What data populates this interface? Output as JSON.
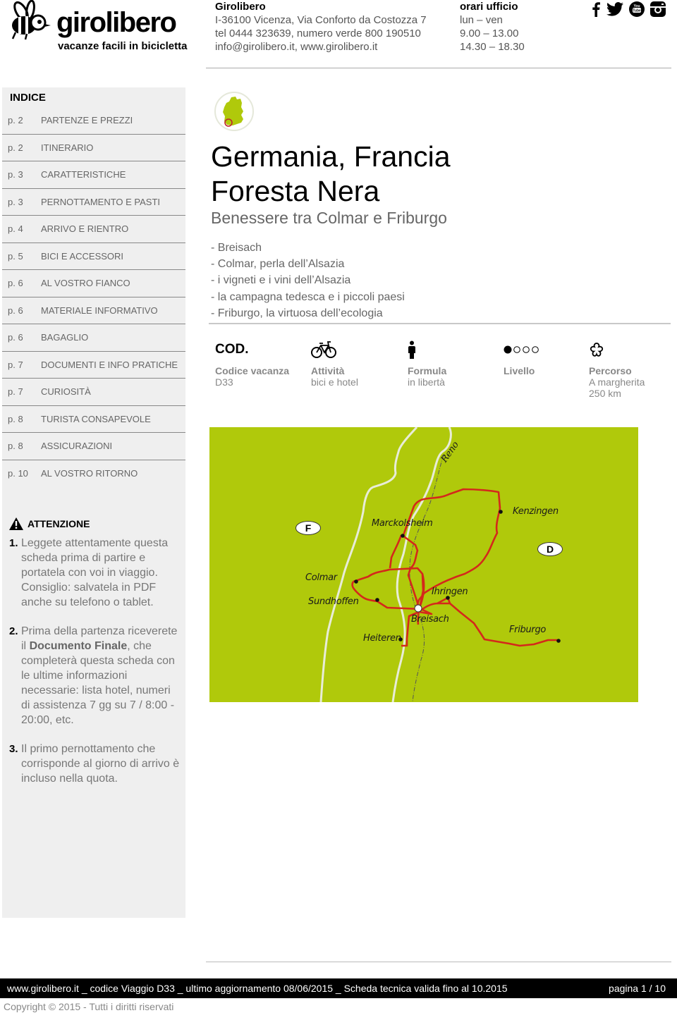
{
  "header": {
    "brand_name": "girolibero",
    "tagline": "vacanze facili in bicicletta",
    "contact": {
      "company": "Girolibero",
      "address": "I-36100 Vicenza, Via Conforto da Costozza 7",
      "phone": "tel 0444 323639, numero verde 800 190510",
      "web": "info@girolibero.it, www.girolibero.it"
    },
    "office_hours": {
      "title": "orari ufficio",
      "days": "lun – ven",
      "morning": "9.00 – 13.00",
      "afternoon": "14.30 – 18.30"
    },
    "social_icons": [
      "facebook-icon",
      "twitter-icon",
      "youtube-icon",
      "instagram-icon"
    ]
  },
  "index": {
    "title": "INDICE",
    "items": [
      {
        "page": "p. 2",
        "label": "PARTENZE E PREZZI"
      },
      {
        "page": "p. 2",
        "label": "ITINERARIO"
      },
      {
        "page": "p. 3",
        "label": "CARATTERISTICHE"
      },
      {
        "page": "p. 3",
        "label": "PERNOTTAMENTO E PASTI"
      },
      {
        "page": "p. 4",
        "label": "ARRIVO E RIENTRO"
      },
      {
        "page": "p. 5",
        "label": "BICI E ACCESSORI"
      },
      {
        "page": "p. 6",
        "label": "AL VOSTRO FIANCO"
      },
      {
        "page": "p. 6",
        "label": "MATERIALE INFORMATIVO"
      },
      {
        "page": "p. 6",
        "label": "BAGAGLIO"
      },
      {
        "page": "p. 7",
        "label": "DOCUMENTI E INFO PRATICHE"
      },
      {
        "page": "p. 7",
        "label": "CURIOSITÀ"
      },
      {
        "page": "p. 8",
        "label": "TURISTA CONSAPEVOLE"
      },
      {
        "page": "p. 8",
        "label": "ASSICURAZIONI"
      },
      {
        "page": "p. 10",
        "label": "AL VOSTRO RITORNO"
      }
    ]
  },
  "attention": {
    "title": "ATTENZIONE",
    "items": [
      {
        "num": "1.",
        "text": "Leggete attentamente questa scheda prima di partire e portatela con voi in viaggio. Consiglio: salvatela in PDF anche su telefono o tablet."
      },
      {
        "num": "2.",
        "pre": "Prima della partenza riceverete il ",
        "bold": "Documento Finale",
        "post": ", che completerà questa scheda con le ultime informazioni necessarie: lista hotel, numeri di assistenza 7 gg su 7 / 8:00 - 20:00, etc."
      },
      {
        "num": "3.",
        "text": "Il primo pernottamento che corrisponde al giorno di arrivo è incluso nella quota."
      }
    ]
  },
  "trip": {
    "title_line1": "Germania, Francia",
    "title_line2": "Foresta Nera",
    "subtitle": "Benessere tra Colmar e Friburgo",
    "highlights": [
      "- Breisach",
      "- Colmar, perla dell’Alsazia",
      "- i vigneti e i vini dell’Alsazia",
      "- la campagna tedesca e i piccoli paesi",
      "- Friburgo, la virtuosa dell’ecologia"
    ],
    "region_colors": {
      "country": "#b0c90b",
      "marker": "#c0272d"
    }
  },
  "features": {
    "code_heading": "COD.",
    "code": {
      "label": "Codice vacanza",
      "value": "D33"
    },
    "activity": {
      "label": "Attività",
      "value": "bici e hotel"
    },
    "formula": {
      "label": "Formula",
      "value": "in libertà"
    },
    "level": {
      "label": "Livello",
      "filled": 1,
      "total": 4
    },
    "route": {
      "label": "Percorso",
      "value": "A margherita",
      "distance": "250 km"
    }
  },
  "map": {
    "background": "#b0c90b",
    "route_color": "#d4281b",
    "river_label": "Reno",
    "countries": [
      "F",
      "D"
    ],
    "towns": [
      "Marckolsheim",
      "Kenzingen",
      "Colmar",
      "Sundhoffen",
      "Ihringen",
      "Breisach",
      "Heiteren",
      "Friburgo"
    ]
  },
  "footer": {
    "bar_text": "www.girolibero.it _ codice Viaggio D33 _ ultimo aggiornamento 08/06/2015 _ Scheda tecnica valida fino al 10.2015",
    "page": "pagina 1 / 10",
    "copyright": "Copyright © 2015  -  Tutti i diritti riservati"
  }
}
